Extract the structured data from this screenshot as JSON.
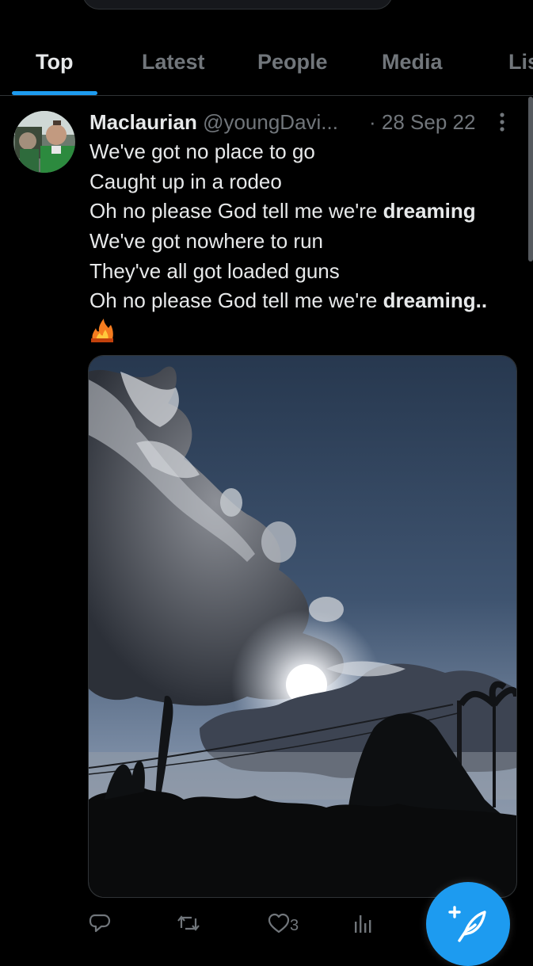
{
  "tabs": [
    {
      "label": "Top",
      "active": true
    },
    {
      "label": "Latest",
      "active": false
    },
    {
      "label": "People",
      "active": false
    },
    {
      "label": "Media",
      "active": false
    },
    {
      "label": "Lis",
      "active": false
    }
  ],
  "tweet": {
    "author_name": "Maclaurian",
    "author_handle": "@youngDavi...",
    "date": "· 28 Sep 22",
    "lines": [
      {
        "text": "We've got no place to go",
        "bold": ""
      },
      {
        "text": "Caught up in a rodeo",
        "bold": ""
      },
      {
        "text": "Oh no please God tell me we're ",
        "bold": "dreaming"
      },
      {
        "text": "We've got nowhere to run",
        "bold": ""
      },
      {
        "text": "They've all got loaded guns",
        "bold": ""
      },
      {
        "text": "Oh no please God tell me we're ",
        "bold": "dreaming.."
      }
    ],
    "emoji": "fire-emoji",
    "media": "sky-with-clouds-and-sun-photo",
    "actions": {
      "reply_count": "",
      "retweet_count": "",
      "like_count": "3",
      "views_count": ""
    }
  },
  "colors": {
    "background": "#000000",
    "accent": "#1d9bf0",
    "text_primary": "#e7e9ea",
    "text_secondary": "#71767b",
    "divider": "#2f3336"
  },
  "icons": [
    "reply-icon",
    "retweet-icon",
    "like-icon",
    "views-icon",
    "more-icon",
    "compose-icon"
  ]
}
